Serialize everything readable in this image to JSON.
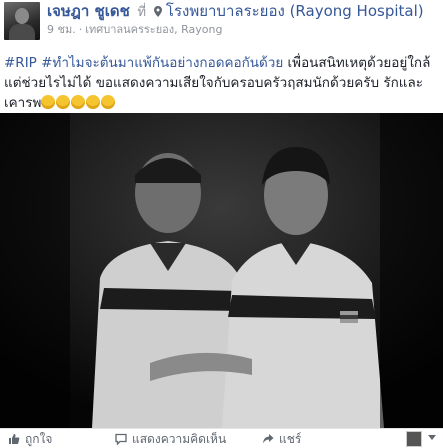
{
  "post": {
    "author": "เจษฎา ชูเดช",
    "at_label": "ที่",
    "place": "โรงพยาบาลระยอง (Rayong Hospital)",
    "time": "9 ชม.",
    "location_detail": "เทศบาลนครระยอง, Rayong",
    "separator": "·",
    "text_line1_hashtags": "#RIP #ทำไมจะต้นมาแพ้กันอย่างกอดคอกันด้วย",
    "text_line1_rest": " เพื่อนสนิทเหตุด้วยอยู่ใกล้",
    "text_line2": "แต่ช่วยไรไม่ได้ ขอแสดงความเสียใจกับครอบครัวฤสมนักด้วยครับ รักและ",
    "text_line3": "เคารพ",
    "emoji_count": 5
  },
  "actions": {
    "like": "ถูกใจ",
    "comment": "แสดงความคิดเห็น",
    "share": "แชร์"
  },
  "icons": {
    "pin": "location-pin-icon",
    "like": "thumbs-up-icon",
    "comment": "comment-bubble-icon",
    "share": "share-arrow-icon",
    "dropdown": "chevron-down-icon"
  },
  "colors": {
    "link": "#365899",
    "meta": "#90949c",
    "action": "#606770"
  }
}
